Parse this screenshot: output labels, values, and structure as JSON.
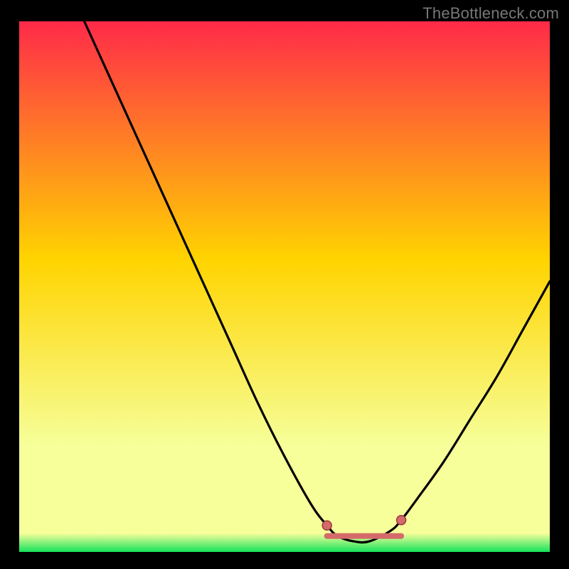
{
  "watermark": "TheBottleneck.com",
  "colors": {
    "background": "#000000",
    "gradient_top": "#ff2a49",
    "gradient_mid": "#ffd400",
    "gradient_low": "#f6ff9a",
    "gradient_bottom": "#14e35a",
    "curve": "#000000",
    "marker_fill": "#d46a6a",
    "marker_stroke": "#9b3b3b"
  },
  "chart_data": {
    "type": "line",
    "title": "",
    "xlabel": "",
    "ylabel": "",
    "xlim": [
      0,
      100
    ],
    "ylim": [
      0,
      100
    ],
    "x": [
      0,
      5,
      10,
      15,
      20,
      25,
      30,
      35,
      40,
      45,
      50,
      55,
      58,
      60,
      63,
      66,
      70,
      72,
      75,
      80,
      85,
      90,
      95,
      100
    ],
    "values": [
      125,
      116,
      105,
      94,
      83,
      72,
      61,
      50,
      39,
      28,
      18,
      9,
      5,
      3,
      2,
      2,
      4,
      6,
      10,
      17,
      25,
      33,
      42,
      51
    ],
    "flat_region": {
      "x_start": 58,
      "x_end": 72,
      "y": 3
    },
    "markers": [
      {
        "x": 58,
        "y": 5
      },
      {
        "x": 72,
        "y": 6
      }
    ]
  }
}
